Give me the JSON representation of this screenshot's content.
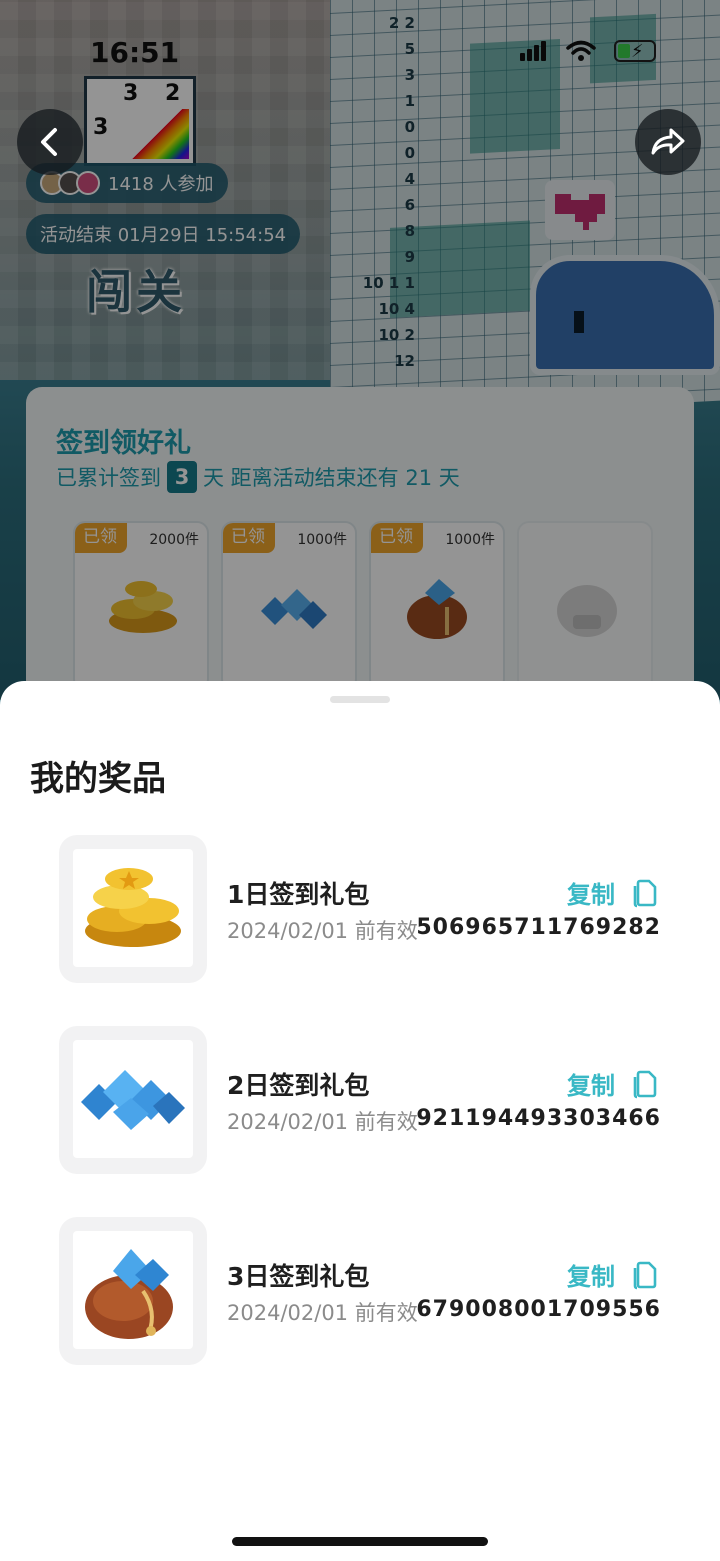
{
  "status_bar": {
    "time": "16:51"
  },
  "hero": {
    "mini_puzzle_numbers": [
      "3",
      "2",
      "3"
    ],
    "grid_clues": [
      "2 2",
      "5",
      "3",
      "1",
      "0",
      "0",
      "4",
      "6",
      "8",
      "9",
      "10 1 1",
      "10 4",
      "10 2",
      "12"
    ],
    "participants": "1418 人参加",
    "event_end": "活动结束 01月29日 15:54:54",
    "title": "闯关"
  },
  "signin_card": {
    "title": "签到领好礼",
    "prefix": "已累计签到",
    "days": "3",
    "suffix": "天  距离活动结束还有 21 天",
    "slots": [
      {
        "tag": "已领",
        "count": "2000件",
        "icon": "gold-coins-icon"
      },
      {
        "tag": "已领",
        "count": "1000件",
        "icon": "blue-gems-icon"
      },
      {
        "tag": "已领",
        "count": "1000件",
        "icon": "gem-bag-icon"
      },
      {
        "tag": "",
        "count": "",
        "icon": "locked-gift-icon"
      }
    ]
  },
  "sheet": {
    "title": "我的奖品",
    "prizes": [
      {
        "name": "1日签到礼包",
        "expiry": "2024/02/01 前有效",
        "code": "506965711769282",
        "copy": "复制",
        "icon": "gold-coins-icon"
      },
      {
        "name": "2日签到礼包",
        "expiry": "2024/02/01 前有效",
        "code": "921194493303466",
        "copy": "复制",
        "icon": "blue-gems-icon"
      },
      {
        "name": "3日签到礼包",
        "expiry": "2024/02/01 前有效",
        "code": "679008001709556",
        "copy": "复制",
        "icon": "gem-bag-icon"
      }
    ]
  },
  "colors": {
    "accent": "#39b8c5",
    "tag": "#f0a62c",
    "card_title": "#1e9cad"
  }
}
